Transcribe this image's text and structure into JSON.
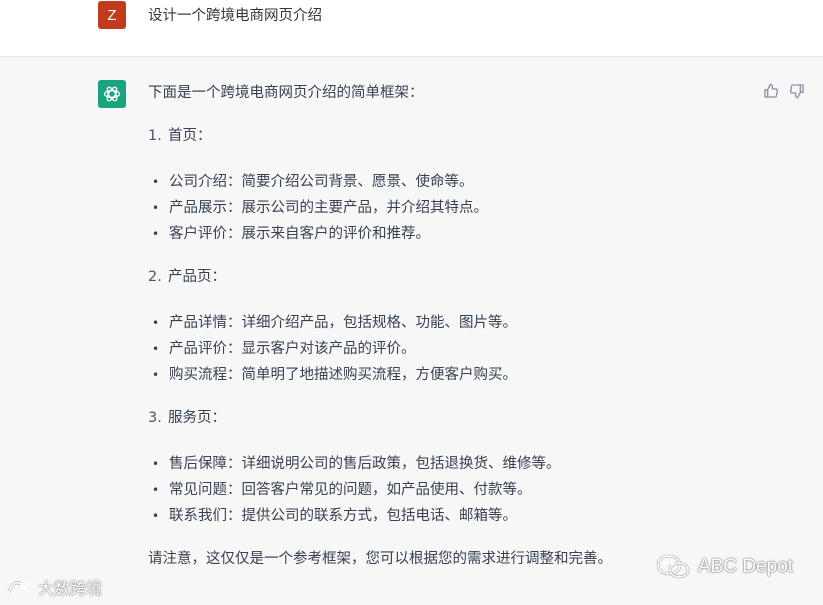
{
  "user_message": {
    "avatar_letter": "Z",
    "text": "设计一个跨境电商网页介绍"
  },
  "assistant_message": {
    "intro": "下面是一个跨境电商网页介绍的简单框架：",
    "sections": [
      {
        "number": "1.",
        "title": "首页：",
        "items": [
          "公司介绍：简要介绍公司背景、愿景、使命等。",
          "产品展示：展示公司的主要产品，并介绍其特点。",
          "客户评价：展示来自客户的评价和推荐。"
        ]
      },
      {
        "number": "2.",
        "title": "产品页：",
        "items": [
          "产品详情：详细介绍产品，包括规格、功能、图片等。",
          "产品评价：显示客户对该产品的评价。",
          "购买流程：简单明了地描述购买流程，方便客户购买。"
        ]
      },
      {
        "number": "3.",
        "title": "服务页：",
        "items": [
          "售后保障：详细说明公司的售后政策，包括退换货、维修等。",
          "常见问题：回答客户常见的问题，如产品使用、付款等。",
          "联系我们：提供公司的联系方式，包括电话、邮箱等。"
        ]
      }
    ],
    "closing": "请注意，这仅仅是一个参考框架，您可以根据您的需求进行调整和完善。",
    "bullet_glyph": "•"
  },
  "icons": {
    "bot_avatar": "openai-logo-icon",
    "thumbs_up": "thumbs-up-icon",
    "thumbs_down": "thumbs-down-icon"
  },
  "watermarks": {
    "left": "大数跨境",
    "right": "ABC Depot"
  },
  "colors": {
    "user_avatar": "#c23a1e",
    "bot_avatar": "#19a37f",
    "assistant_bg": "#f7f7f8"
  }
}
